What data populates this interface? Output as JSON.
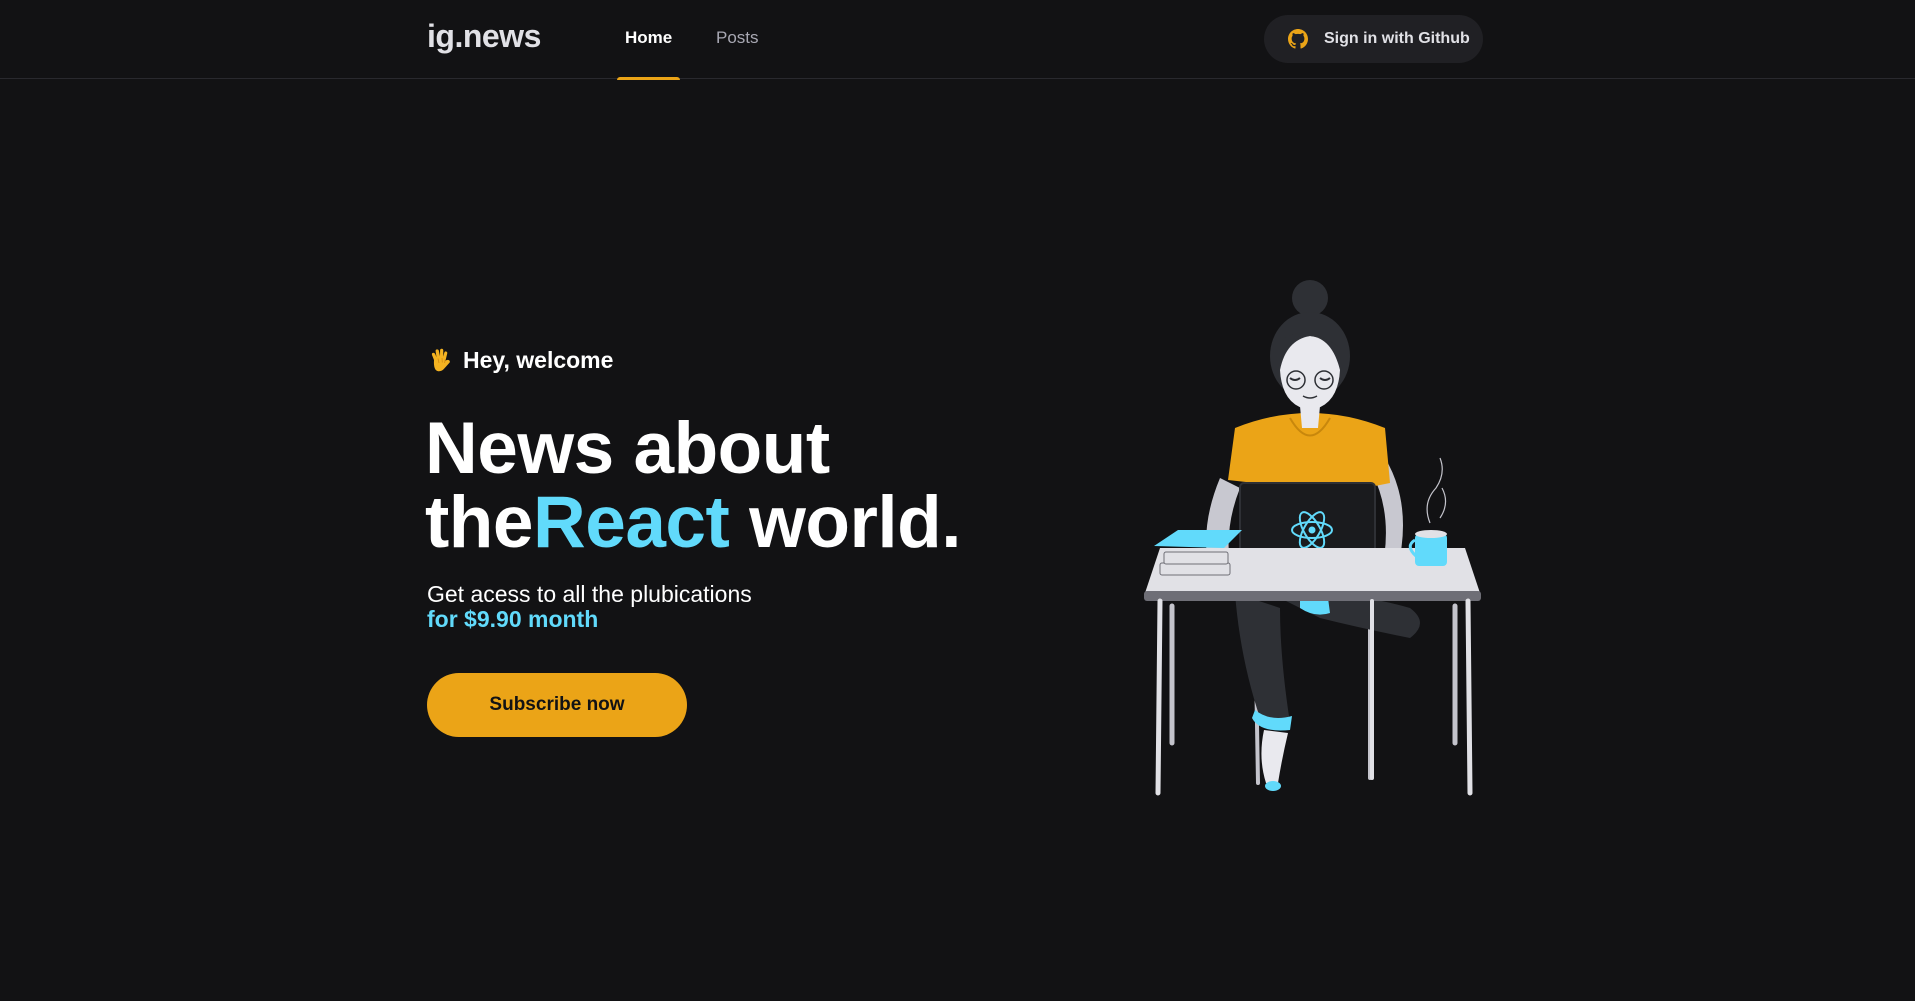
{
  "header": {
    "logo": "ig.news",
    "nav": [
      {
        "label": "Home",
        "active": true
      },
      {
        "label": "Posts",
        "active": false
      }
    ],
    "signin": {
      "label": "Sign in with Github",
      "icon": "github-icon"
    }
  },
  "hero": {
    "welcome_icon": "waving-hand-icon",
    "welcome": "Hey, welcome",
    "headline_line1": "News about",
    "headline_the": "the",
    "headline_react": "React",
    "headline_world": " world.",
    "subtitle": "Get acess to all the plubications",
    "price": "for $9.90 month",
    "cta": "Subscribe now"
  },
  "illustration": {
    "icon": "woman-coding-with-react-laptop-illustration"
  },
  "colors": {
    "background": "#121214",
    "header_border": "#29292e",
    "accent_yellow": "#eba417",
    "accent_cyan": "#61dafb",
    "button_dark": "#202024",
    "text_light": "#e1e1e6",
    "text_muted": "#a8a8b3"
  }
}
